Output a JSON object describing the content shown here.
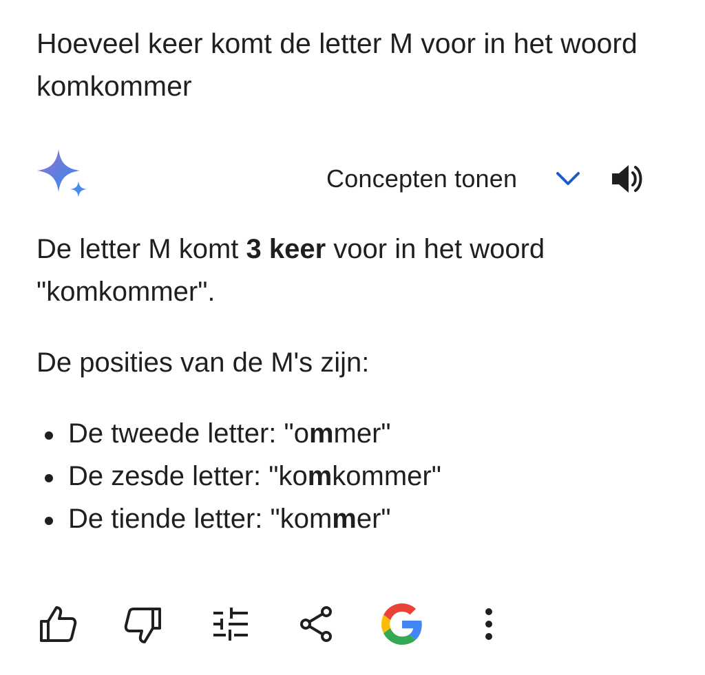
{
  "prompt": {
    "text": "Hoeveel keer komt de letter M voor in het woord komkommer"
  },
  "response_header": {
    "logo_icon": "gemini-sparkle-icon",
    "drafts_label": "Concepten tonen",
    "chevron_icon": "chevron-down-icon",
    "speaker_icon": "speaker-icon",
    "accent_color": "#1a73e8"
  },
  "answer": {
    "p1_before": "De letter M komt ",
    "p1_bold": "3 keer",
    "p1_after": " voor in het woord \"komkommer\".",
    "p2": "De posities van de M's zijn:",
    "items": [
      {
        "label": "De tweede letter: ",
        "word_pre": "\"o",
        "word_bold": "m",
        "word_post": "mer\""
      },
      {
        "label": "De zesde letter: ",
        "word_pre": "\"ko",
        "word_bold": "m",
        "word_post": "kommer\""
      },
      {
        "label": "De tiende letter: ",
        "word_pre": "\"kom",
        "word_bold": "m",
        "word_post": "er\""
      }
    ]
  },
  "actions": {
    "thumbs_up": "thumbs-up-icon",
    "thumbs_down": "thumbs-down-icon",
    "modify": "tune-icon",
    "share": "share-icon",
    "google": "google-g-icon",
    "more": "more-vert-icon"
  }
}
